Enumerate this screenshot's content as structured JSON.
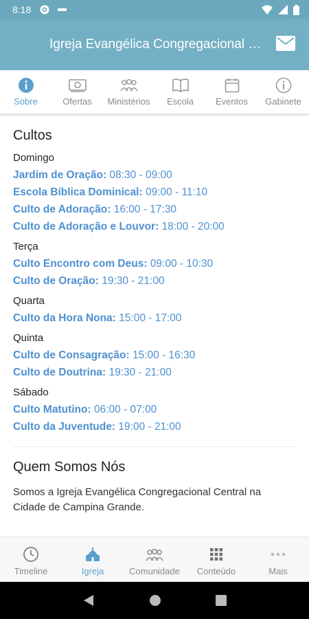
{
  "status_bar": {
    "time": "8:18"
  },
  "app_bar": {
    "title": "Igreja Evangélica Congregacional Central",
    "mail_icon": "mail-icon"
  },
  "top_tabs": [
    {
      "label": "Sobre",
      "icon": "info-icon",
      "active": true
    },
    {
      "label": "Ofertas",
      "icon": "money-icon",
      "active": false
    },
    {
      "label": "Ministérios",
      "icon": "people-icon",
      "active": false
    },
    {
      "label": "Escola",
      "icon": "book-icon",
      "active": false
    },
    {
      "label": "Eventos",
      "icon": "calendar-icon",
      "active": false
    },
    {
      "label": "Gabinete",
      "icon": "info-outline-icon",
      "active": false
    }
  ],
  "cultos": {
    "title": "Cultos",
    "days": [
      {
        "day": "Domingo",
        "services": [
          {
            "name": "Jardim de Oração:",
            "time": "08:30 - 09:00"
          },
          {
            "name": "Escola Bíblica Dominical:",
            "time": "09:00 - 11:10"
          },
          {
            "name": "Culto de Adoração:",
            "time": "16:00 - 17:30"
          },
          {
            "name": "Culto de Adoração e Louvor:",
            "time": "18:00 - 20:00"
          }
        ]
      },
      {
        "day": "Terça",
        "services": [
          {
            "name": "Culto Encontro com Deus:",
            "time": "09:00 - 10:30"
          },
          {
            "name": "Culto de Oração:",
            "time": "19:30 - 21:00"
          }
        ]
      },
      {
        "day": "Quarta",
        "services": [
          {
            "name": "Culto da Hora Nona:",
            "time": "15:00 - 17:00"
          }
        ]
      },
      {
        "day": "Quinta",
        "services": [
          {
            "name": "Culto de Consagração:",
            "time": "15:00 - 16:30"
          },
          {
            "name": "Culto de Doutrina:",
            "time": "19:30 - 21:00"
          }
        ]
      },
      {
        "day": "Sábado",
        "services": [
          {
            "name": "Culto Matutino:",
            "time": "06:00 - 07:00"
          },
          {
            "name": "Culto da Juventude:",
            "time": "19:00 - 21:00"
          }
        ]
      }
    ]
  },
  "about": {
    "title": "Quem Somos Nós",
    "text": "Somos a Igreja Evangélica Congregacional Central na Cidade de Campina Grande."
  },
  "bottom_nav": [
    {
      "label": "Timeline",
      "icon": "clock-icon",
      "active": false
    },
    {
      "label": "Igreja",
      "icon": "church-icon",
      "active": true
    },
    {
      "label": "Comunidade",
      "icon": "community-icon",
      "active": false
    },
    {
      "label": "Conteúdo",
      "icon": "grid-icon",
      "active": false
    },
    {
      "label": "Mais",
      "icon": "more-icon",
      "active": false
    }
  ],
  "colors": {
    "header": "#74b0c5",
    "accent": "#5aa0cf",
    "link": "#4f90d0"
  }
}
